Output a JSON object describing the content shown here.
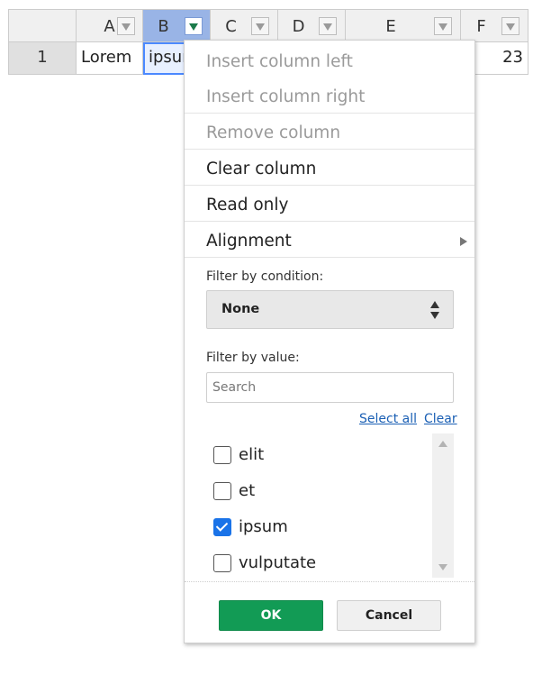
{
  "grid": {
    "columns": [
      {
        "label": "A",
        "value": "Lorem"
      },
      {
        "label": "B",
        "value": "ipsum"
      },
      {
        "label": "C",
        "value": ""
      },
      {
        "label": "D",
        "value": ""
      },
      {
        "label": "E",
        "value": ""
      },
      {
        "label": "F",
        "value": "23"
      }
    ],
    "row_header": "1"
  },
  "menu": {
    "insert_left": "Insert column left",
    "insert_right": "Insert column right",
    "remove_column": "Remove column",
    "clear_column": "Clear column",
    "read_only": "Read only",
    "alignment": "Alignment",
    "filter_by_condition": "Filter by condition:",
    "condition_value": "None",
    "filter_by_value": "Filter by value:",
    "search_placeholder": "Search",
    "select_all": "Select all",
    "clear": "Clear",
    "values": [
      {
        "label": "elit",
        "checked": false
      },
      {
        "label": "et",
        "checked": false
      },
      {
        "label": "ipsum",
        "checked": true
      },
      {
        "label": "vulputate",
        "checked": false
      }
    ],
    "ok": "OK",
    "cancel": "Cancel"
  },
  "colors": {
    "selected_header": "#99b4e6",
    "selection_border": "#4b89ff",
    "ok_button": "#129b55",
    "checkbox_checked": "#1a73e8",
    "link": "#1a5fb4"
  }
}
